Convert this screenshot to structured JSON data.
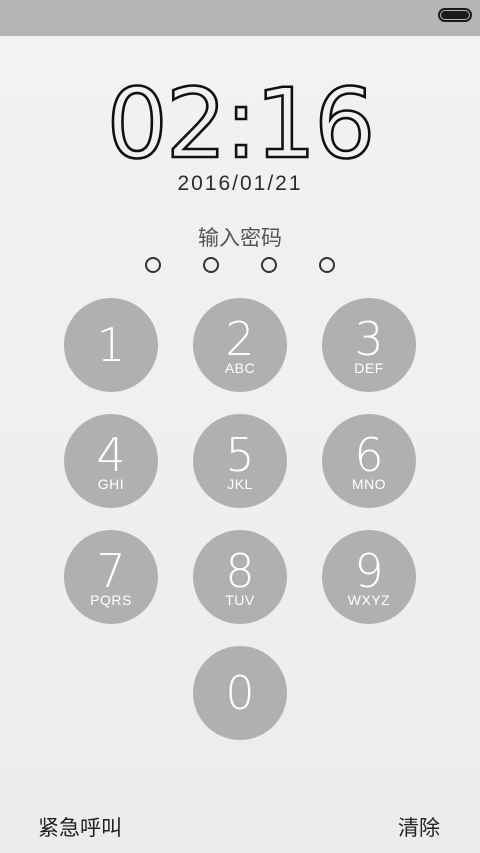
{
  "status_bar": {
    "battery_icon": "battery-full-icon"
  },
  "lockscreen": {
    "time_hours": "02",
    "time_sep": ":",
    "time_minutes": "16",
    "date": "2016/01/21",
    "prompt": "输入密码"
  },
  "keypad": {
    "keys": [
      {
        "digit": "1",
        "letters": ""
      },
      {
        "digit": "2",
        "letters": "ABC"
      },
      {
        "digit": "3",
        "letters": "DEF"
      },
      {
        "digit": "4",
        "letters": "GHI"
      },
      {
        "digit": "5",
        "letters": "JKL"
      },
      {
        "digit": "6",
        "letters": "MNO"
      },
      {
        "digit": "7",
        "letters": "PQRS"
      },
      {
        "digit": "8",
        "letters": "TUV"
      },
      {
        "digit": "9",
        "letters": "WXYZ"
      },
      {
        "digit": "0",
        "letters": ""
      }
    ]
  },
  "footer": {
    "emergency_label": "紧急呼叫",
    "clear_label": "清除"
  },
  "colors": {
    "key_bg": "#b0b0b0",
    "status_bar_bg": "#b5b5b5",
    "text_dark": "#111111"
  }
}
